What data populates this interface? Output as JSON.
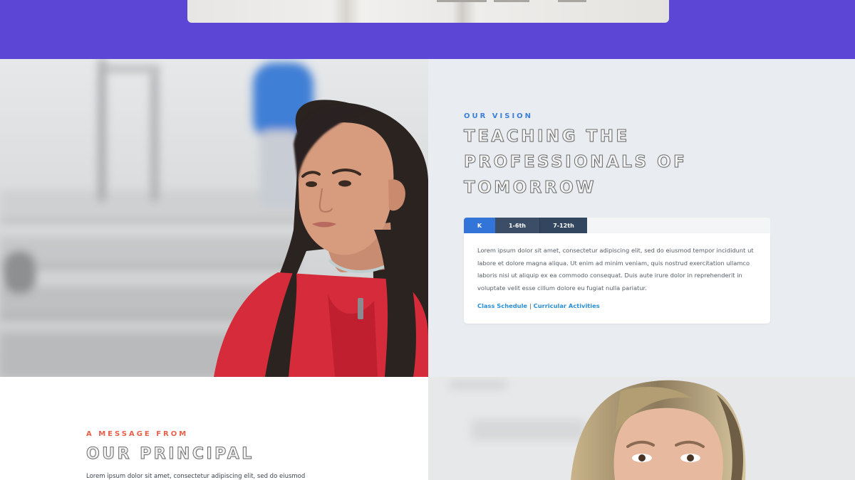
{
  "vision": {
    "eyebrow": "OUR VISION",
    "title_lines": [
      "TEACHING THE",
      "PROFESSIONALS OF",
      "TOMORROW"
    ],
    "tabs": [
      {
        "label": "K"
      },
      {
        "label": "1-6th"
      },
      {
        "label": "7-12th"
      }
    ],
    "active_tab": "K",
    "body": "Lorem ipsum dolor sit amet, consectetur adipiscing elit, sed do eiusmod tempor incididunt ut labore et dolore magna aliqua. Ut enim ad minim veniam, quis nostrud exercitation ullamco laboris nisi ut aliquip ex ea commodo consequat. Duis aute irure dolor in reprehenderit in voluptate velit esse cillum dolore eu fugiat nulla pariatur.",
    "links": [
      "Class Schedule",
      "Curricular Activities"
    ],
    "link_separator": "|"
  },
  "principal": {
    "eyebrow": "A MESSAGE FROM",
    "title": "OUR PRINCIPAL",
    "body_preview": "Lorem ipsum dolor sit amet, consectetur adipiscing elit, sed do eiusmod"
  },
  "colors": {
    "top_band": "#5b46d6",
    "accent_blue": "#3374d8",
    "tab_dark": "#3c4e67",
    "accent_red": "#e5614b",
    "panel_bg": "#e9edf1"
  }
}
